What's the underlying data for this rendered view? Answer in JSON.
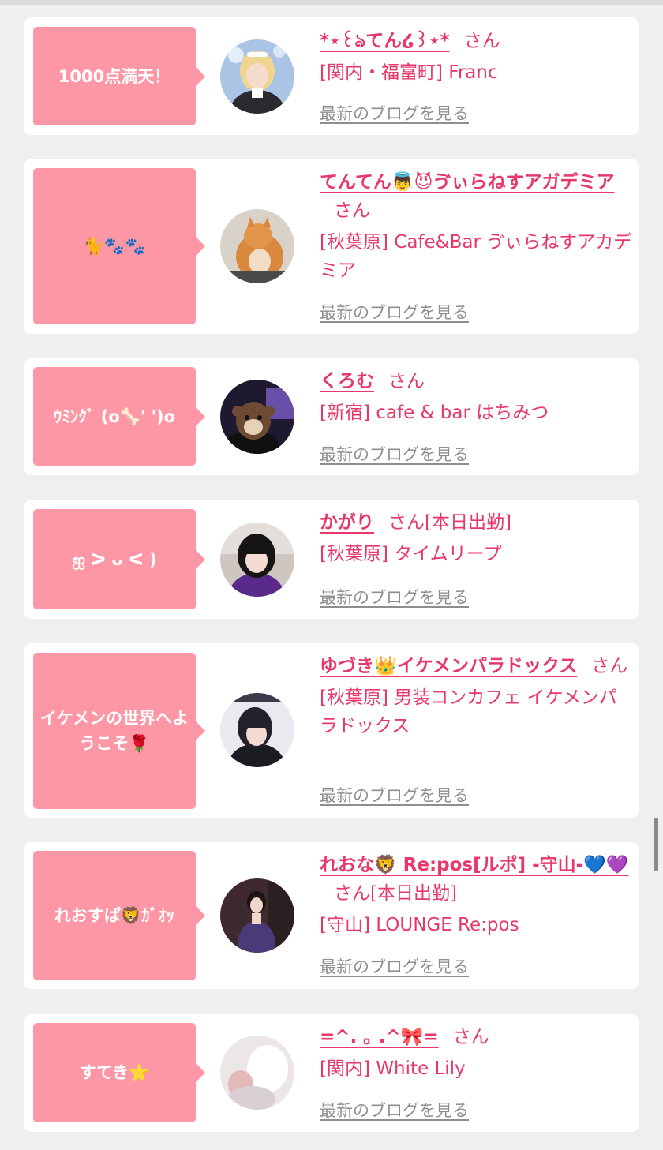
{
  "cards": [
    {
      "bubble": "1000点満天！",
      "name": "*⋆꒰ঌてん໒꒱⋆*",
      "suffix": "さん",
      "status": "",
      "location": "[関内・福富町] Franc",
      "blog_link": "最新のブログを見る",
      "avatar_icon": "avatar-photo-blonde-maid"
    },
    {
      "bubble": "🐈🐾🐾",
      "name": "てんてん👼😈ゔぃらねすアガデミア",
      "suffix": "さん",
      "status": "",
      "location": "[秋葉原] Cafe&Bar ゔぃらねすアカデミア",
      "blog_link": "最新のブログを見る",
      "avatar_icon": "avatar-photo-cat"
    },
    {
      "bubble": "ｳﾐﾝｸﾞ (o🦴' ')o",
      "name": "くろむ",
      "suffix": "さん",
      "status": "",
      "location": "[新宿] cafe & bar はちみつ",
      "blog_link": "最新のブログを見る",
      "avatar_icon": "avatar-photo-plush"
    },
    {
      "bubble": "ஐ ᐳ ᴗ ᐸ )",
      "name": "かがり",
      "suffix": "さん",
      "status": "[本日出勤]",
      "location": "[秋葉原] タイムリープ",
      "blog_link": "最新のブログを見る",
      "avatar_icon": "avatar-photo-dark-hair"
    },
    {
      "bubble": "イケメンの世界へようこそ🌹",
      "name": "ゆづき👑イケメンパラドックス",
      "suffix": "さん",
      "status": "",
      "location": "[秋葉原] 男装コンカフェ イケメンパラドックス",
      "blog_link": "最新のブログを見る",
      "avatar_icon": "avatar-photo-ikemen"
    },
    {
      "bubble": "れおすぱ🦁ｶﾞｵｯ",
      "name": "れおな🦁 Re:pos[ルポ] -守山-💙💜",
      "suffix": "さん",
      "status": "[本日出勤]",
      "location": "[守山] LOUNGE Re:pos",
      "blog_link": "最新のブログを見る",
      "avatar_icon": "avatar-photo-dress"
    },
    {
      "bubble": "すてき⭐",
      "name": "=^. ｡ .^🎀=",
      "suffix": "さん",
      "status": "",
      "location": "[関内] White Lily",
      "blog_link": "最新のブログを見る",
      "avatar_icon": "avatar-photo-blurred"
    }
  ]
}
